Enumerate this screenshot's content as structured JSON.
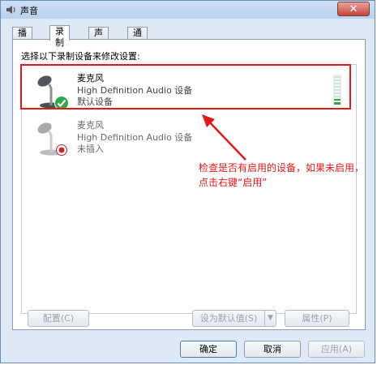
{
  "window": {
    "title": "声音",
    "close_label": "✕"
  },
  "tabs": [
    {
      "label": "播放",
      "active": false
    },
    {
      "label": "录制",
      "active": true
    },
    {
      "label": "声音",
      "active": false
    },
    {
      "label": "通信",
      "active": false
    }
  ],
  "instruction": "选择以下录制设备来修改设置:",
  "devices": [
    {
      "name": "麦克风",
      "description": "High Definition Audio 设备",
      "status": "默认设备",
      "icon": "microphone-icon",
      "badge": "default-check-icon"
    },
    {
      "name": "麦克风",
      "description": "High Definition Audio 设备",
      "status": "未插入",
      "icon": "microphone-icon",
      "badge": "unplugged-icon"
    }
  ],
  "annotation": "检查是否有启用的设备，如果未启用，点击右键“启用”",
  "buttons": {
    "configure": "配置(C)",
    "set_default": "设为默认值(S)",
    "properties": "属性(P)",
    "ok": "确定",
    "cancel": "取消",
    "apply": "应用(A)"
  },
  "colors": {
    "highlight": "#e0191a",
    "window_frame": "#dfe9f5",
    "level_meter": "#2fa84a"
  }
}
